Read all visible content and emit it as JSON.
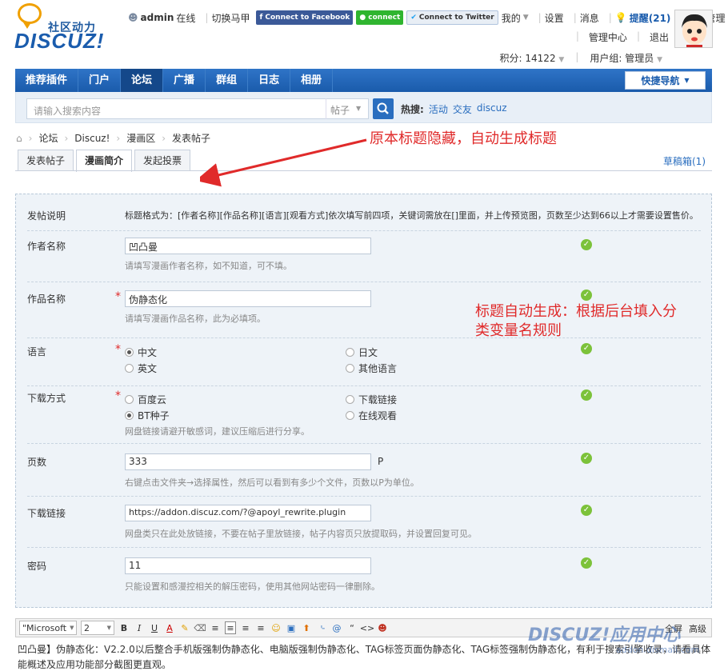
{
  "logo": {
    "slogan": "社区动力",
    "brand": "DISCUZ!"
  },
  "topbar": {
    "user": "admin",
    "online": "在线",
    "switch": "切换马甲",
    "facebook": "Connect to Facebook",
    "line": "connect",
    "twitter": "Connect to Twitter",
    "mine": "我的",
    "settings": "设置",
    "messages": "消息",
    "reminder": "提醒(21)",
    "portal_manage": "门户管理",
    "admin_center": "管理中心",
    "logout": "退出",
    "points": "积分: 14122",
    "usergroup": "用户组: 管理员"
  },
  "nav": {
    "items": [
      "推荐插件",
      "门户",
      "论坛",
      "广播",
      "群组",
      "日志",
      "相册"
    ],
    "active_index": 2,
    "quick": "快捷导航"
  },
  "search": {
    "placeholder": "请输入搜索内容",
    "type": "帖子",
    "hot_label": "热搜:",
    "hot": [
      "活动",
      "交友",
      "discuz"
    ]
  },
  "breadcrumb": [
    "论坛",
    "Discuz!",
    "漫画区",
    "发表帖子"
  ],
  "tabs": [
    "发表帖子",
    "漫画简介",
    "发起投票"
  ],
  "active_tab": 1,
  "draft": "草稿箱(1)",
  "annotations": {
    "a1": "原本标题隐藏，自动生成标题",
    "a2_line1": "标题自动生成：根据后台填入分",
    "a2_line2": "类变量名规则"
  },
  "form": {
    "desc_label": "发帖说明",
    "desc_text": "标题格式为：[作者名称][作品名称][语言][观看方式]依次填写前四项，关键词需放在[]里面，并上传预览图，页数至少达到66以上才需要设置售价。",
    "author": {
      "label": "作者名称",
      "value": "凹凸曼",
      "tip": "请填写漫画作者名称，如不知道，可不填。"
    },
    "work": {
      "label": "作品名称",
      "value": "伪静态化",
      "tip": "请填写漫画作品名称，此为必填项。"
    },
    "lang": {
      "label": "语言",
      "options": [
        "中文",
        "日文",
        "英文",
        "其他语言"
      ],
      "selected": "中文"
    },
    "method": {
      "label": "下载方式",
      "options": [
        "百度云",
        "下载链接",
        "BT种子",
        "在线观看"
      ],
      "selected": "BT种子",
      "tip": "网盘链接请避开敏感词，建议压缩后进行分享。"
    },
    "pages": {
      "label": "页数",
      "value": "333",
      "unit": "P",
      "tip": "右键点击文件夹→选择属性，然后可以看到有多少个文件，页数以P为单位。"
    },
    "link": {
      "label": "下载链接",
      "value": "https://addon.discuz.com/?@apoyl_rewrite.plugin",
      "tip": "网盘类只在此处放链接，不要在帖子里放链接，帖子内容页只放提取码，并设置回复可见。"
    },
    "password": {
      "label": "密码",
      "value": "11",
      "tip": "只能设置和感漫控相关的解压密码，使用其他网站密码一律删除。"
    }
  },
  "editor": {
    "font": "\"Microsoft",
    "size": "2",
    "right1": "全屏",
    "right2": "高级",
    "content_line1": "凹凸曼】伪静态化：V2.2.0以后整合手机版强制伪静态化、电脑版强制伪静态化、TAG标签页面伪静态化、TAG标签强制伪静态化，有利于搜索引擎收录，请看具体功",
    "content_line2": "能概述及应用功能部分截图更直观。"
  },
  "watermark": {
    "brand": "DISCUZ!应用中心",
    "sub": "addon.dismall.com"
  }
}
